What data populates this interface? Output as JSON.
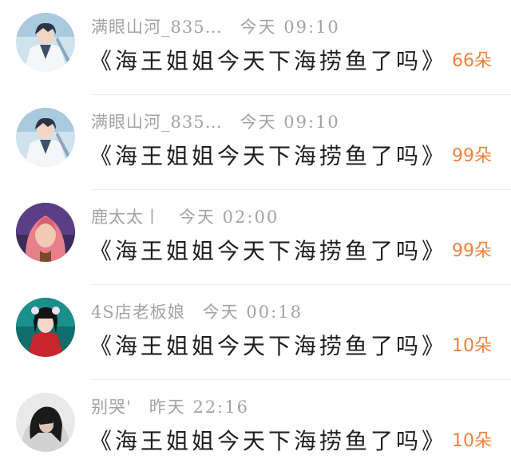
{
  "items": [
    {
      "username": "满眼山河_835…",
      "time": "今天 09:10",
      "title": "《海王姐姐今天下海捞鱼了吗》",
      "count": "66朵",
      "avatar": "anime-boy-avatar-icon"
    },
    {
      "username": "满眼山河_835…",
      "time": "今天 09:10",
      "title": "《海王姐姐今天下海捞鱼了吗》",
      "count": "99朵",
      "avatar": "anime-boy-avatar-icon"
    },
    {
      "username": "鹿太太丨",
      "time": "今天 02:00",
      "title": "《海王姐姐今天下海捞鱼了吗》",
      "count": "99朵",
      "avatar": "pink-hair-girl-avatar-icon"
    },
    {
      "username": "4S店老板娘",
      "time": "今天 00:18",
      "title": "《海王姐姐今天下海捞鱼了吗》",
      "count": "10朵",
      "avatar": "red-dress-girl-avatar-icon"
    },
    {
      "username": "别哭'",
      "time": "昨天 22:16",
      "title": "《海王姐姐今天下海捞鱼了吗》",
      "count": "10朵",
      "avatar": "dark-hair-girl-avatar-icon"
    }
  ],
  "colors": {
    "count": "#f0813a",
    "meta": "#a3a3a3",
    "title": "#1e1e1e"
  }
}
